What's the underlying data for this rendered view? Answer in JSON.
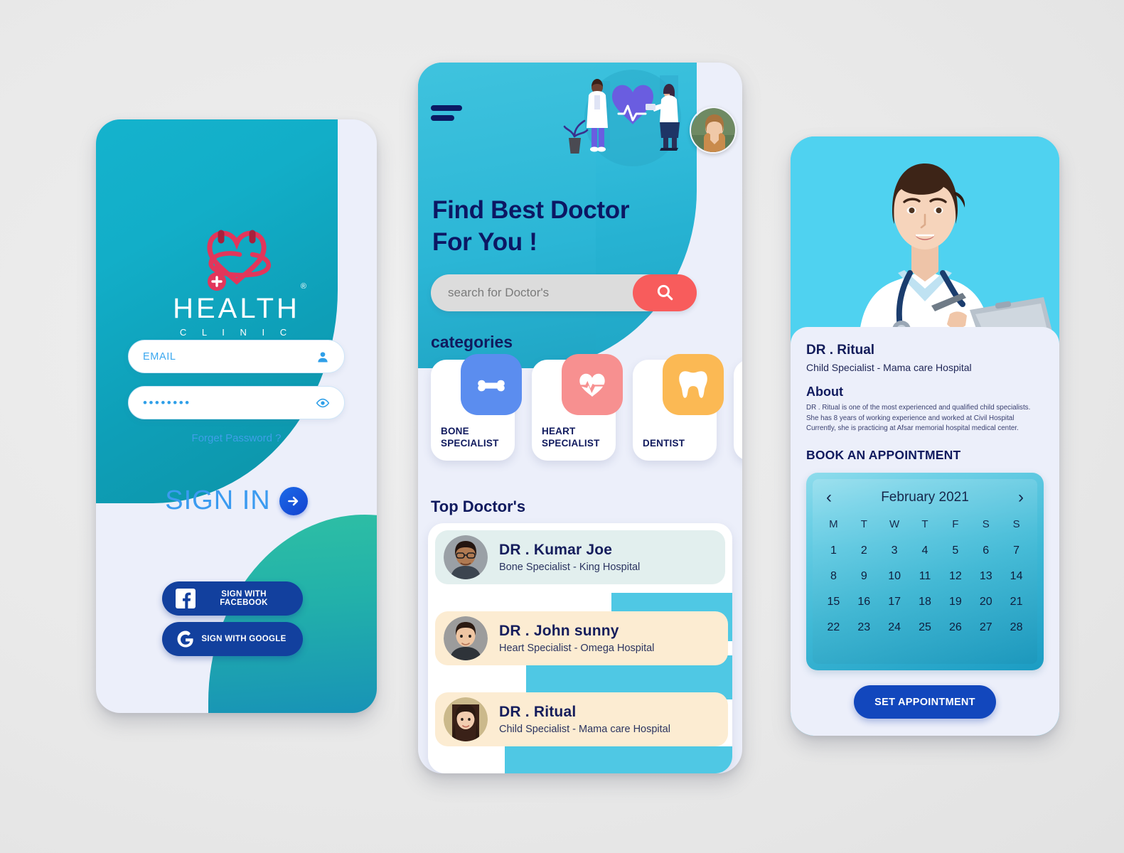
{
  "app": {
    "name": "Health Clinic",
    "background_color": "#eceded"
  },
  "login": {
    "logo": {
      "word": "HEALTH",
      "registered": "®",
      "sub": "C L I N I C",
      "icon": "heart-stethoscope-icon"
    },
    "email_field": {
      "placeholder": "EMAIL",
      "value": "",
      "icon": "person-icon"
    },
    "password_field": {
      "value": "••••••••",
      "icon": "eye-icon"
    },
    "forget_password": "Forget Password ?",
    "signin_label": "SIGN IN",
    "signin_arrow_icon": "arrow-right-icon",
    "facebook_label": "SIGN WITH FACEBOOK",
    "facebook_icon": "facebook-icon",
    "google_label": "SIGN WITH GOOGLE",
    "google_icon": "google-icon",
    "colors": {
      "teal": "#12aec8",
      "blob_top": "#2ebfa4",
      "blob_bottom": "#1459ad",
      "accent_blue": "#3b9bf0",
      "social_blue": "#12409e"
    }
  },
  "home": {
    "menu_icon": "hamburger-menu-icon",
    "avatar_icon": "user-avatar",
    "hero_illustration": "doctors-heartbeat-illustration",
    "title_line1": "Find Best Doctor",
    "title_line2": "For You !",
    "search": {
      "placeholder": "search for Doctor's",
      "value": "",
      "button_icon": "search-icon",
      "button_color": "#f85c5c"
    },
    "categories_title": "categories",
    "categories": [
      {
        "label": "BONE\nSPECIALIST",
        "icon": "bone-icon",
        "color": "#5b8def"
      },
      {
        "label": "HEART\nSPECIALIST",
        "icon": "heart-pulse-icon",
        "color": "#f79090"
      },
      {
        "label": "DENTIST",
        "icon": "tooth-icon",
        "color": "#fbb954"
      },
      {
        "label": "",
        "icon": "partial-card",
        "color": "#ffffff"
      }
    ],
    "top_doctors_title": "Top Doctor's",
    "doctors": [
      {
        "name": "DR . Kumar Joe",
        "spec": "Bone Specialist - King Hospital",
        "avatar": "doctor-kumar-photo",
        "bg": "#e2efee"
      },
      {
        "name": "DR . John sunny",
        "spec": "Heart  Specialist - Omega Hospital",
        "avatar": "doctor-john-photo",
        "bg": "#fcecd2"
      },
      {
        "name": "DR . Ritual",
        "spec": "Child Specialist - Mama care Hospital",
        "avatar": "doctor-ritual-photo",
        "bg": "#fcecd2"
      }
    ]
  },
  "detail": {
    "hero_photo": "doctor-ritual-portrait",
    "name": "DR . Ritual",
    "spec": "Child Specialist - Mama care Hospital",
    "about_heading": "About",
    "about_text": "DR . Ritual  is one of the most experienced and qualified child specialists. She has 8 years of working experience and worked at Civil Hospital Currently, she is practicing at Afsar memorial hospital medical center.",
    "book_heading": "BOOK AN APPOINTMENT",
    "calendar": {
      "month_label": "February 2021",
      "prev_icon": "chevron-left-icon",
      "next_icon": "chevron-right-icon",
      "dow": [
        "M",
        "T",
        "W",
        "T",
        "F",
        "S",
        "S"
      ],
      "days": [
        1,
        2,
        3,
        4,
        5,
        6,
        7,
        8,
        9,
        10,
        11,
        12,
        13,
        14,
        15,
        16,
        17,
        18,
        19,
        20,
        21,
        22,
        23,
        24,
        25,
        26,
        27,
        28
      ]
    },
    "set_appointment_label": "SET APPOINTMENT"
  }
}
